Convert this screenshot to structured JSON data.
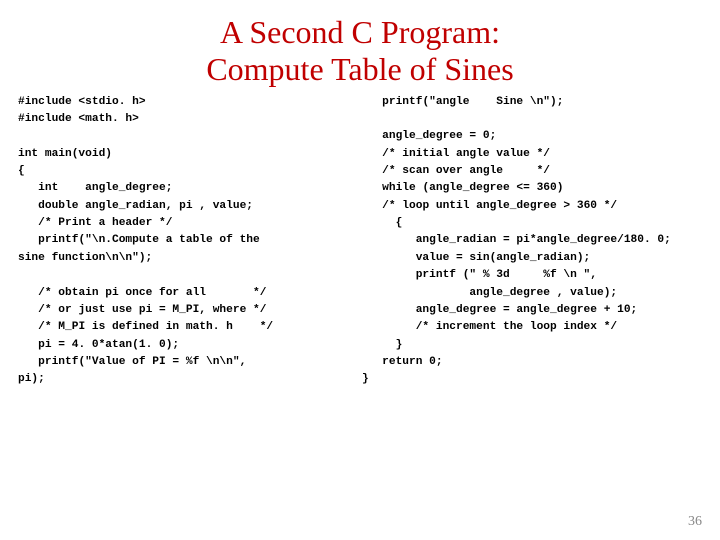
{
  "title_line1": "A Second C Program:",
  "title_line2": "Compute Table of Sines",
  "code_left": "#include <stdio. h>\n#include <math. h>\n\nint main(void)\n{\n   int    angle_degree;\n   double angle_radian, pi , value;\n   /* Print a header */\n   printf(\"\\n.Compute a table of the\nsine function\\n\\n\");\n\n   /* obtain pi once for all       */\n   /* or just use pi = M_PI, where */\n   /* M_PI is defined in math. h    */\n   pi = 4. 0*atan(1. 0);\n   printf(\"Value of PI = %f \\n\\n\",\npi);",
  "code_right": "   printf(\"angle    Sine \\n\");\n\n   angle_degree = 0;\n   /* initial angle value */\n   /* scan over angle     */\n   while (angle_degree <= 360)\n   /* loop until angle_degree > 360 */\n     {\n        angle_radian = pi*angle_degree/180. 0;\n        value = sin(angle_radian);\n        printf (\" % 3d     %f \\n \",\n                angle_degree , value);\n        angle_degree = angle_degree + 10;\n        /* increment the loop index */\n     }\n   return 0;\n}",
  "page_number": "36"
}
